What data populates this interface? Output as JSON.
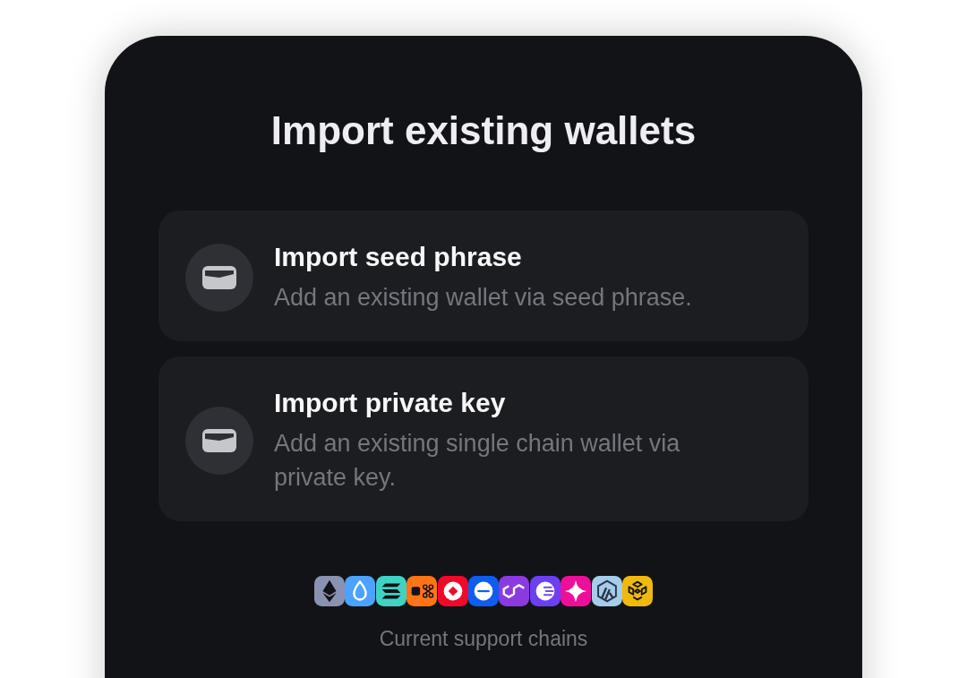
{
  "title": "Import existing wallets",
  "options": [
    {
      "title": "Import seed phrase",
      "description": "Add an existing wallet via seed phrase."
    },
    {
      "title": "Import private key",
      "description": "Add an existing single chain wallet via private key."
    }
  ],
  "chains": {
    "logos": [
      {
        "kind": "diamond",
        "color": "#8a92b2"
      },
      {
        "kind": "droplet",
        "color": "#4da2ff"
      },
      {
        "kind": "stripes",
        "color": "#40d3c4"
      },
      {
        "kind": "dots",
        "color": "#ff7417"
      },
      {
        "kind": "ring",
        "color": "#ef0a2a"
      },
      {
        "kind": "bar",
        "color": "#0d5ef0"
      },
      {
        "kind": "links",
        "color": "#8b3ae0"
      },
      {
        "kind": "waves",
        "color": "#6c3ff2"
      },
      {
        "kind": "sparkle",
        "color": "#ee0e9c"
      },
      {
        "kind": "hexagon",
        "color": "#a3cdea"
      },
      {
        "kind": "cube",
        "color": "#f0b90b"
      }
    ],
    "caption": "Current support chains"
  }
}
